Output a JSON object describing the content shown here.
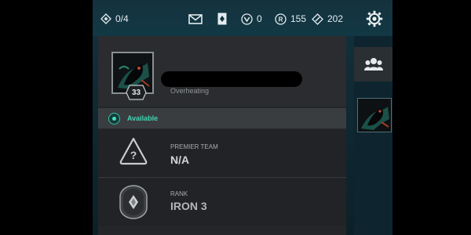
{
  "topbar": {
    "missions": "0/4",
    "kingdom_credits": "0",
    "radianite": "155",
    "valorant_points": "202",
    "icons": [
      "diamond-icon",
      "mail-icon",
      "card-icon",
      "vp-icon",
      "radianite-icon",
      "kingdom-icon",
      "settings-gear-icon"
    ]
  },
  "profile": {
    "level": "33",
    "title": "Overheating",
    "status": "Available"
  },
  "premier": {
    "label": "PREMIER TEAM",
    "value": "N/A"
  },
  "rank": {
    "label": "RANK",
    "value": "IRON 3"
  },
  "sidebar": {
    "icons": [
      "social-people-icon",
      "friend-avatar"
    ]
  },
  "colors": {
    "status_green": "#42d4b2",
    "panel_bg": "#252629",
    "topbar_bg": "#14323d"
  }
}
